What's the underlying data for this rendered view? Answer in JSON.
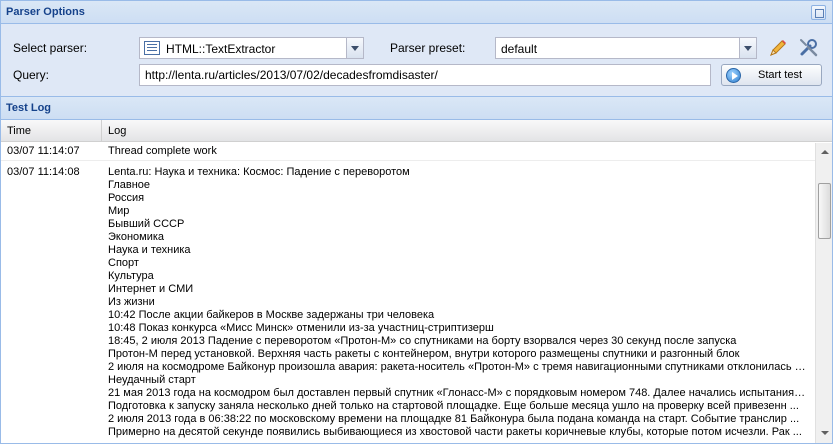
{
  "parser_options": {
    "title": "Parser Options",
    "select_parser_label": "Select parser:",
    "select_parser_value": "HTML::TextExtractor",
    "parser_preset_label": "Parser preset:",
    "parser_preset_value": "default",
    "query_label": "Query:",
    "query_value": "http://lenta.ru/articles/2013/07/02/decadesfromdisaster/",
    "start_test_label": "Start test"
  },
  "test_log": {
    "title": "Test Log",
    "columns": [
      "Time",
      "Log"
    ],
    "rows": [
      {
        "time": "03/07 11:14:07",
        "lines": [
          "Thread complete work"
        ]
      },
      {
        "time": "03/07 11:14:08",
        "lines": [
          "Lenta.ru: Наука и техника: Космос: Падение с переворотом",
          "Главное",
          "Россия",
          "Мир",
          "Бывший СССР",
          "Экономика",
          "Наука и техника",
          "Спорт",
          "Культура",
          "Интернет и СМИ",
          "Из жизни",
          "10:42 После акции байкеров в Москве задержаны три человека",
          "10:48 Показ конкурса «Мисс Минск» отменили из-за участниц-стриптизерш",
          "18:45, 2 июля 2013 Падение с переворотом «Протон-М» со спутниками на борту взорвался через 30 секунд после запуска",
          "Протон-М перед установкой. Верхняя часть ракеты с контейнером, внутри которого размещены спутники и разгонный блок",
          "2 июля на космодроме Байконур произошла авария: ракета-носитель «Протон-М» с тремя навигационными спутниками отклонилась о...",
          "Неудачный старт",
          "21 мая 2013 года на космодром был доставлен первый спутник «Глонасс-М» с порядковым номером 748. Далее начались испытания,   ...",
          "Подготовка к запуску заняла несколько дней только на стартовой площадке. Еще больше месяца ушло на проверку всей привезенн   ...",
          "2 июля 2013 года в 06:38:22 по московскому времени на площадке 81 Байконура была подана команда на старт. Событие транслир   ...",
          "Примерно на десятой секунде появились выбивающиеся из хвостовой части ракеты коричневые клубы, которые потом исчезли. Рак   ..."
        ]
      }
    ]
  }
}
